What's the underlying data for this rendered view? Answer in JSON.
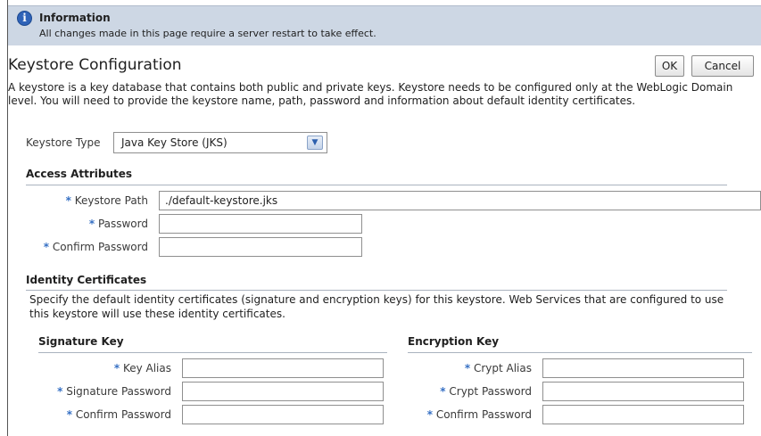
{
  "info": {
    "icon": "info-icon",
    "icon_glyph": "i",
    "title": "Information",
    "message": "All changes made in this page require a server restart to take effect."
  },
  "page": {
    "title": "Keystore Configuration",
    "ok_label": "OK",
    "cancel_label": "Cancel",
    "description": "A keystore is a key database that contains both public and private keys. Keystore needs to be configured only at the WebLogic Domain level. You will need to provide the keystore name, path, password and information about default identity certificates."
  },
  "required_marker": "*",
  "keystore_type": {
    "label": "Keystore Type",
    "selected": "Java Key Store (JKS)",
    "dropdown_icon": "chevron-down-icon"
  },
  "access_attributes": {
    "heading": "Access Attributes",
    "keystore_path_label": "Keystore Path",
    "keystore_path_value": "./default-keystore.jks",
    "password_label": "Password",
    "password_value": "",
    "confirm_password_label": "Confirm Password",
    "confirm_password_value": ""
  },
  "identity_certificates": {
    "heading": "Identity Certificates",
    "description": "Specify the default identity certificates (signature and encryption keys) for this keystore. Web Services that are configured to use this keystore will use these identity certificates."
  },
  "signature_key": {
    "heading": "Signature Key",
    "key_alias_label": "Key Alias",
    "signature_password_label": "Signature Password",
    "confirm_password_label": "Confirm Password"
  },
  "encryption_key": {
    "heading": "Encryption Key",
    "crypt_alias_label": "Crypt Alias",
    "crypt_password_label": "Crypt Password",
    "confirm_password_label": "Confirm Password"
  },
  "colors": {
    "info_bar_bg": "#cdd7e4",
    "required_star": "#3670c4",
    "info_icon": "#2f63b8"
  }
}
